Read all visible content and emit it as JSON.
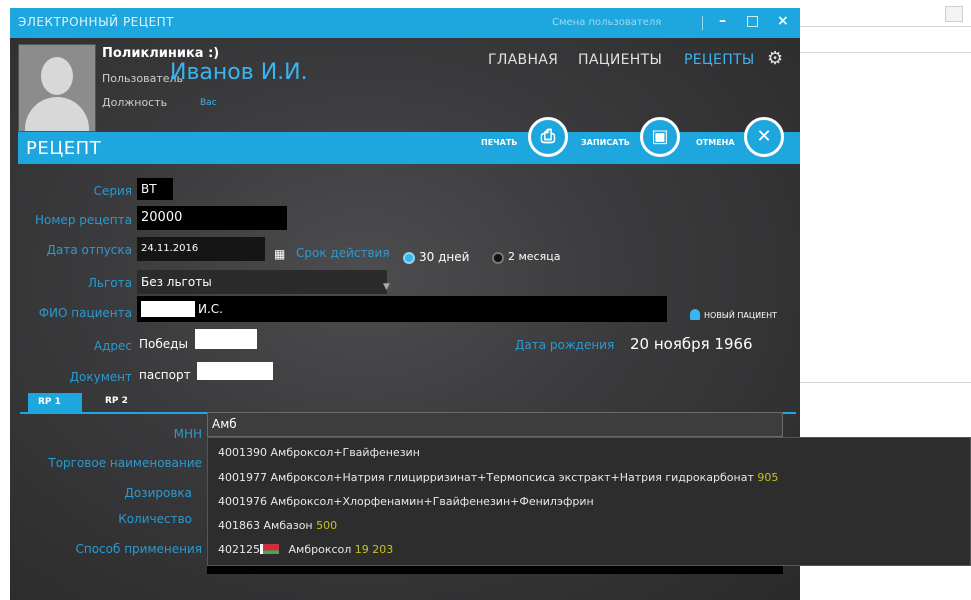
{
  "window": {
    "title": "ЭЛЕКТРОННЫЙ РЕЦЕПТ",
    "change_user": "Смена пользователя",
    "minimize": "–",
    "maximize": "□",
    "close": "×"
  },
  "header": {
    "clinic": "Поликлиника :)",
    "user_label": "Пользователь",
    "user_name": "Иванов И.И.",
    "position_label": "Должность",
    "position_value": "Вас"
  },
  "nav": {
    "items": [
      "ГЛАВНАЯ",
      "ПАЦИЕНТЫ",
      "РЕЦЕПТЫ"
    ],
    "active": "РЕЦЕПТЫ",
    "settings_icon": "gear-icon"
  },
  "recipe_bar": {
    "title": "РЕЦЕПТ",
    "print_label": "ПЕЧАТЬ",
    "save_label": "ЗАПИСАТЬ",
    "cancel_label": "ОТМЕНА",
    "print_icon": "printer-icon",
    "save_icon": "floppy-icon",
    "cancel_icon": "close-icon"
  },
  "form": {
    "series_label": "Серия",
    "series_value": "ВТ",
    "number_label": "Номер рецепта",
    "number_value": "20000",
    "date_label": "Дата отпуска",
    "date_value": "24.11.2016",
    "validity_label": "Срок действия",
    "validity_options": [
      "30 дней",
      "2 месяца"
    ],
    "validity_selected": "30 дней",
    "benefit_label": "Льгота",
    "benefit_value": "Без льготы",
    "patient_label": "ФИО пациента",
    "patient_value": "И.С.",
    "new_patient": "НОВЫЙ ПАЦИЕНТ",
    "address_label": "Адрес",
    "address_value": "Победы",
    "birthdate_label": "Дата рождения",
    "birthdate_value": "20 ноября 1966",
    "document_label": "Документ",
    "document_value": "паспорт"
  },
  "tabs": [
    "RP 1",
    "RP 2"
  ],
  "rp": {
    "mnn_label": "МНН",
    "mnn_value": "Амб",
    "trade_label": "Торговое наименование",
    "dose_label": "Дозировка",
    "qty_label": "Количество",
    "method_label": "Способ применения"
  },
  "suggestions": [
    {
      "code": "4001390",
      "name": "Амброксол+Гвайфенезин",
      "price": ""
    },
    {
      "code": "4001977",
      "name": "Амброксол+Натрия глицирризинат+Термопсиса экстракт+Натрия гидрокарбонат",
      "price": "905"
    },
    {
      "code": "4001976",
      "name": "Амброксол+Хлорфенамин+Гвайфенезин+Фенилэфрин",
      "price": ""
    },
    {
      "code": "401863",
      "name": "Амбазон",
      "price": "500"
    },
    {
      "code": "402125",
      "name": "Амброксол",
      "price": "19 203"
    }
  ],
  "colors": {
    "accent": "#1ea7de",
    "label_blue": "#2a9ad0",
    "price_yellow": "#c7c41a",
    "panel_dark": "#3a3a3c"
  }
}
